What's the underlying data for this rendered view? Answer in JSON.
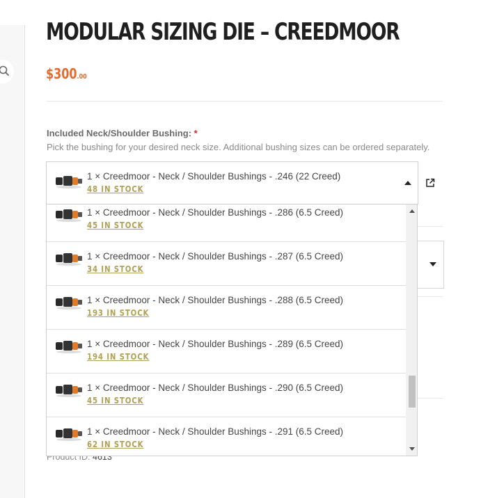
{
  "product": {
    "title": "MODULAR SIZING DIE – CREEDMOOR",
    "price_main": "$300",
    "price_cents": ".00",
    "id_label": "Product ID:",
    "id_value": "4613"
  },
  "bushing_field": {
    "label": "Included Neck/Shoulder Bushing:",
    "required_mark": "*",
    "description": "Pick the bushing for your desired neck size. Additional bushing sizes can be ordered separately.",
    "selected": {
      "text": "1 × Creedmoor - Neck / Shoulder Bushings - .246 (22 Creed)",
      "stock": "48 IN STOCK"
    }
  },
  "dropdown": {
    "options": [
      {
        "text": "1 × Creedmoor - Neck / Shoulder Bushings - .286 (6.5 Creed)",
        "stock": "45 IN STOCK"
      },
      {
        "text": "1 × Creedmoor - Neck / Shoulder Bushings - .287 (6.5 Creed)",
        "stock": "34 IN STOCK"
      },
      {
        "text": "1 × Creedmoor - Neck / Shoulder Bushings - .288 (6.5 Creed)",
        "stock": "193 IN STOCK"
      },
      {
        "text": "1 × Creedmoor - Neck / Shoulder Bushings - .289 (6.5 Creed)",
        "stock": "194 IN STOCK"
      },
      {
        "text": "1 × Creedmoor - Neck / Shoulder Bushings - .290 (6.5 Creed)",
        "stock": "45 IN STOCK"
      },
      {
        "text": "1 × Creedmoor - Neck / Shoulder Bushings - .291 (6.5 Creed)",
        "stock": "62 IN STOCK"
      }
    ],
    "scroll_position_fraction": 0.68
  },
  "icons": {
    "search": "search-icon",
    "external": "external-link-icon",
    "caret_up": "caret-up-icon",
    "caret_down": "caret-down-icon",
    "thumbnail": "bushing-thumbnail-icon"
  },
  "colors": {
    "price": "#e56a2e",
    "stock": "#b0a157",
    "required": "#d9232e",
    "title": "#1f1f1f"
  }
}
